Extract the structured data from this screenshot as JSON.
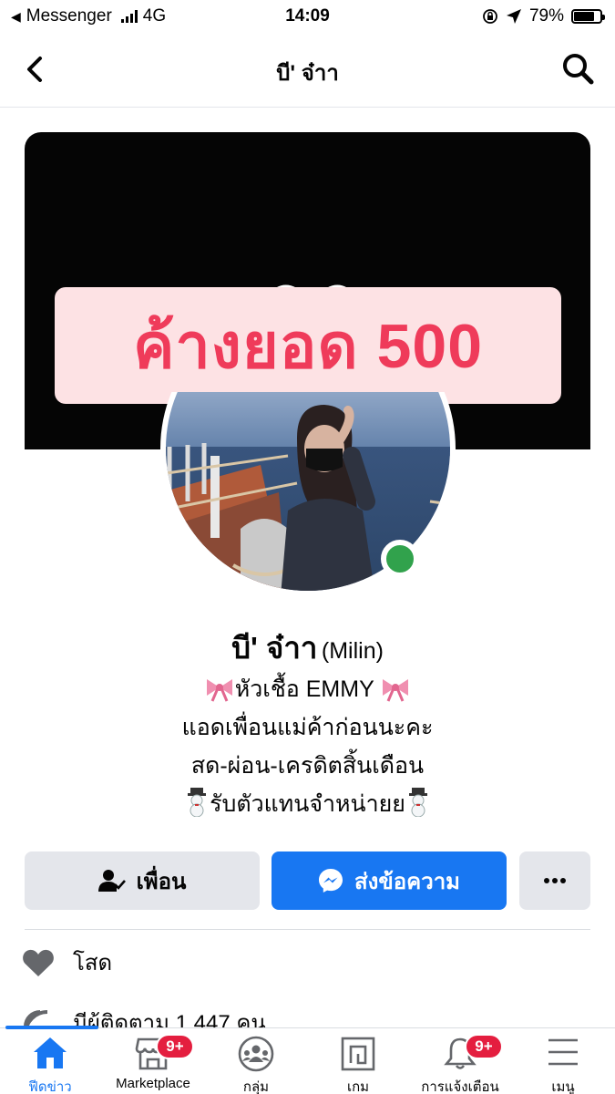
{
  "status_bar": {
    "back_app": "Messenger",
    "network": "4G",
    "time": "14:09",
    "battery": "79%",
    "battery_level": 0.79
  },
  "header": {
    "title": "บี' จ๋าา",
    "back_icon": "chevron-left-icon",
    "search_icon": "search-icon"
  },
  "cover": {
    "overlay_text": "ค้างยอด 500",
    "overlay_bg": "#fde2e4",
    "overlay_color": "#ef3b5a"
  },
  "profile": {
    "name": "บี' จ๋าา",
    "alt_name": "(Milin)",
    "online": true,
    "bio": {
      "line1_text": "หัวเชื้อ EMMY ",
      "line2": "แอดเพื่อนแม่ค้าก่อนนะคะ",
      "line3": "สด-ผ่อน-เครดิตสิ้นเดือน",
      "line4_text": "รับตัวแทนจำหน่ายย"
    }
  },
  "actions": {
    "friend_label": "เพื่อน",
    "message_label": "ส่งข้อความ",
    "more_icon": "more-dots-icon"
  },
  "info": {
    "relationship": "โสด",
    "followers": "มีผู้ติดตาม 1,447 คน"
  },
  "tabs": [
    {
      "label": "ฟีดข่าว",
      "icon": "home-icon",
      "active": true
    },
    {
      "label": "Marketplace",
      "icon": "marketplace-icon",
      "badge": "9+"
    },
    {
      "label": "กลุ่ม",
      "icon": "groups-icon"
    },
    {
      "label": "เกม",
      "icon": "gaming-icon"
    },
    {
      "label": "การแจ้งเตือน",
      "icon": "bell-icon",
      "badge": "9+"
    },
    {
      "label": "เมนู",
      "icon": "menu-icon"
    }
  ],
  "colors": {
    "accent": "#1877f2",
    "badge": "#e41e3f",
    "online": "#31a24c"
  }
}
